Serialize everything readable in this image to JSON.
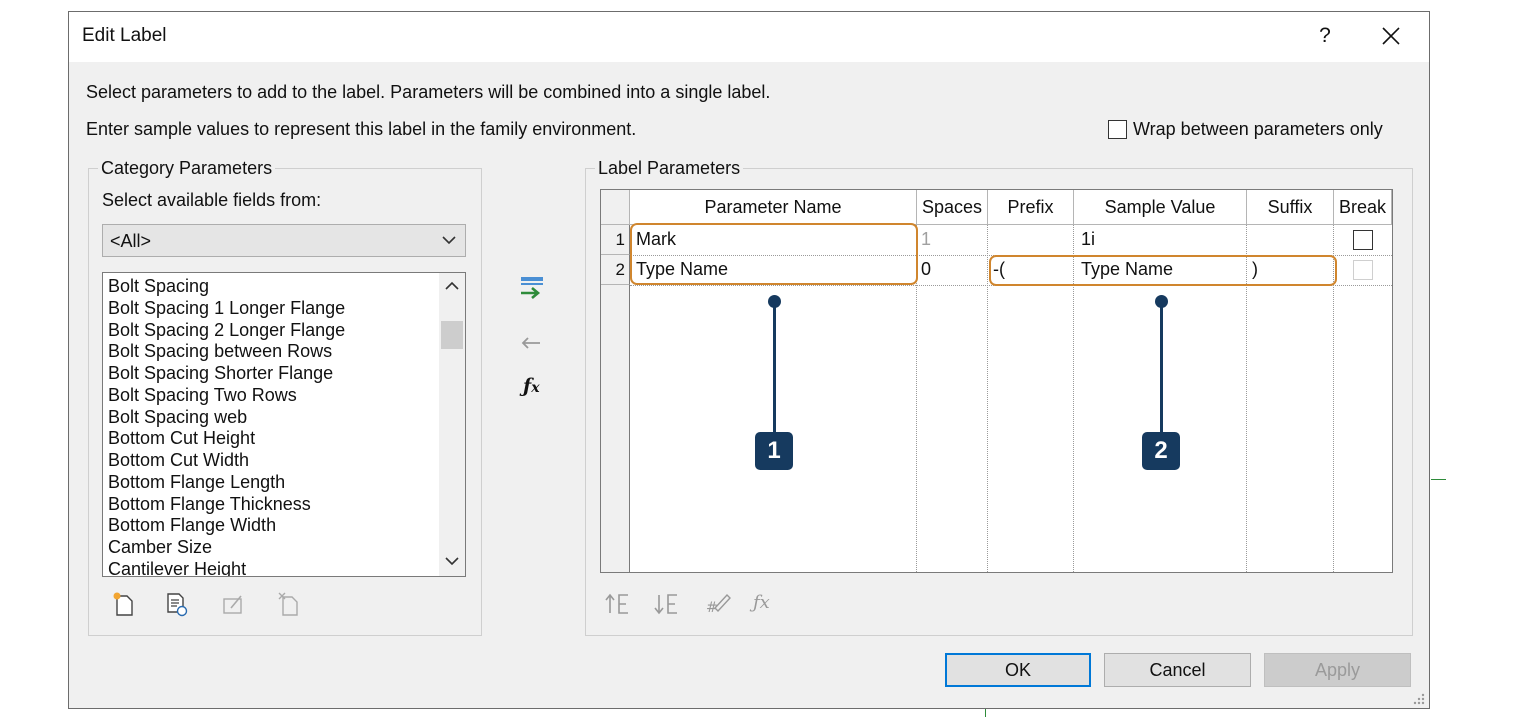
{
  "dialog": {
    "title": "Edit Label",
    "help": "?",
    "instruction1": "Select parameters to add to the label.  Parameters will be combined into a single label.",
    "instruction2": "Enter sample values to represent this label in the family environment.",
    "wrap_label": "Wrap between parameters only",
    "wrap_checked": false
  },
  "category": {
    "title": "Category Parameters",
    "select_label": "Select available fields from:",
    "combo_value": "<All>",
    "fields": [
      "Bolt Spacing",
      "Bolt Spacing 1 Longer Flange",
      "Bolt Spacing 2 Longer Flange",
      "Bolt Spacing between Rows",
      "Bolt Spacing Shorter Flange",
      "Bolt Spacing Two Rows",
      "Bolt Spacing web",
      "Bottom Cut Height",
      "Bottom Cut Width",
      "Bottom Flange Length",
      "Bottom Flange Thickness",
      "Bottom Flange Width",
      "Camber Size",
      "Cantilever Height"
    ]
  },
  "label_params": {
    "title": "Label Parameters",
    "columns": [
      "Parameter Name",
      "Spaces",
      "Prefix",
      "Sample Value",
      "Suffix",
      "Break"
    ],
    "rows": [
      {
        "num": "1",
        "name": "Mark",
        "spaces": "1",
        "prefix": "",
        "sample": "1i",
        "suffix": ""
      },
      {
        "num": "2",
        "name": "Type Name",
        "spaces": "0",
        "prefix": "-(",
        "sample": "Type Name",
        "suffix": ")"
      }
    ]
  },
  "callouts": [
    "1",
    "2"
  ],
  "buttons": {
    "ok": "OK",
    "cancel": "Cancel",
    "apply": "Apply"
  },
  "colors": {
    "highlight": "#d0862e",
    "callout": "#163a5f",
    "ok_border": "#0078d7"
  }
}
